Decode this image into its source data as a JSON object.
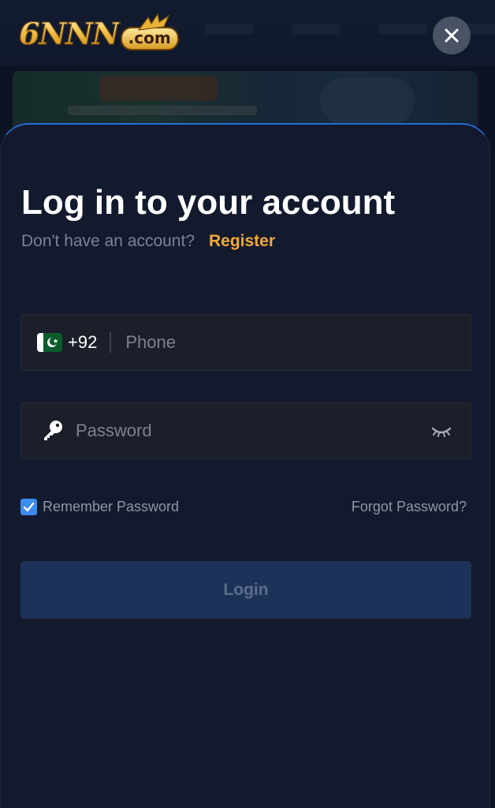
{
  "brand": {
    "logo_text": "6NNN",
    "logo_suffix": ".com"
  },
  "close": {
    "icon": "close-icon"
  },
  "login": {
    "title": "Log in to your account",
    "subtitle": "Don't have an account?",
    "register_link": "Register",
    "phone": {
      "country_flag": "pakistan-flag-icon",
      "dial_code": "+92",
      "placeholder": "Phone",
      "value": ""
    },
    "password": {
      "icon": "key-icon",
      "placeholder": "Password",
      "value": "",
      "toggle_icon": "eye-closed-icon"
    },
    "remember_password": {
      "label": "Remember Password",
      "checked": true
    },
    "forgot_password": "Forgot Password?",
    "submit_label": "Login"
  },
  "colors": {
    "background": "#131a2d",
    "accent_link": "#f2a83b",
    "sheet_border": "#2a6bd6",
    "checkbox": "#3c8cf0",
    "login_button": "#1c3258"
  }
}
